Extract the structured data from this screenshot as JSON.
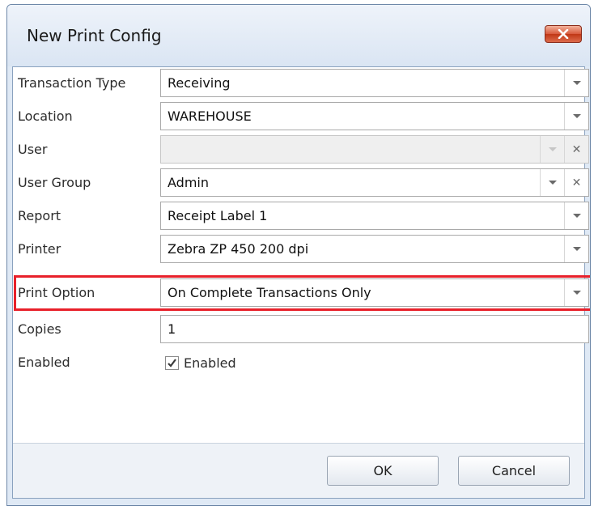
{
  "window": {
    "title": "New Print Config"
  },
  "form": {
    "rows": [
      {
        "label": "Transaction Type",
        "value": "Receiving"
      },
      {
        "label": "Location",
        "value": "WAREHOUSE"
      },
      {
        "label": "User",
        "value": ""
      },
      {
        "label": "User Group",
        "value": "Admin"
      },
      {
        "label": "Report",
        "value": "Receipt Label 1"
      },
      {
        "label": "Printer",
        "value": "Zebra ZP 450 200 dpi"
      },
      {
        "label": "Print Option",
        "value": "On Complete Transactions Only"
      },
      {
        "label": "Copies",
        "value": "1"
      }
    ],
    "enabled": {
      "label": "Enabled",
      "checkbox_label": "Enabled",
      "checked": true
    }
  },
  "footer": {
    "ok_label": "OK",
    "cancel_label": "Cancel"
  },
  "colors": {
    "highlight": "#e8202a",
    "close_button": "#c03716"
  }
}
